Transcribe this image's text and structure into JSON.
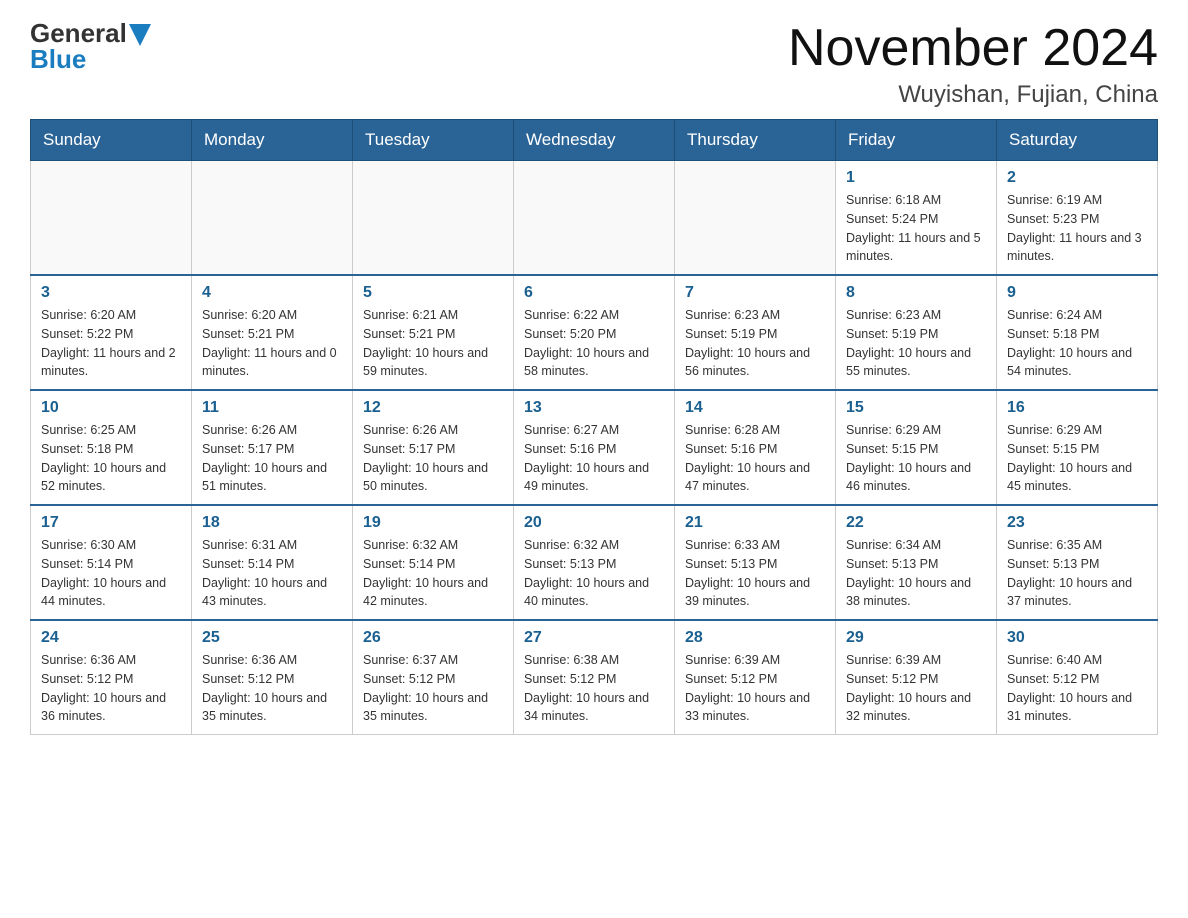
{
  "header": {
    "logo_general": "General",
    "logo_blue": "Blue",
    "title": "November 2024",
    "subtitle": "Wuyishan, Fujian, China"
  },
  "days_of_week": [
    "Sunday",
    "Monday",
    "Tuesday",
    "Wednesday",
    "Thursday",
    "Friday",
    "Saturday"
  ],
  "weeks": [
    [
      {
        "day": "",
        "info": ""
      },
      {
        "day": "",
        "info": ""
      },
      {
        "day": "",
        "info": ""
      },
      {
        "day": "",
        "info": ""
      },
      {
        "day": "",
        "info": ""
      },
      {
        "day": "1",
        "info": "Sunrise: 6:18 AM\nSunset: 5:24 PM\nDaylight: 11 hours and 5 minutes."
      },
      {
        "day": "2",
        "info": "Sunrise: 6:19 AM\nSunset: 5:23 PM\nDaylight: 11 hours and 3 minutes."
      }
    ],
    [
      {
        "day": "3",
        "info": "Sunrise: 6:20 AM\nSunset: 5:22 PM\nDaylight: 11 hours and 2 minutes."
      },
      {
        "day": "4",
        "info": "Sunrise: 6:20 AM\nSunset: 5:21 PM\nDaylight: 11 hours and 0 minutes."
      },
      {
        "day": "5",
        "info": "Sunrise: 6:21 AM\nSunset: 5:21 PM\nDaylight: 10 hours and 59 minutes."
      },
      {
        "day": "6",
        "info": "Sunrise: 6:22 AM\nSunset: 5:20 PM\nDaylight: 10 hours and 58 minutes."
      },
      {
        "day": "7",
        "info": "Sunrise: 6:23 AM\nSunset: 5:19 PM\nDaylight: 10 hours and 56 minutes."
      },
      {
        "day": "8",
        "info": "Sunrise: 6:23 AM\nSunset: 5:19 PM\nDaylight: 10 hours and 55 minutes."
      },
      {
        "day": "9",
        "info": "Sunrise: 6:24 AM\nSunset: 5:18 PM\nDaylight: 10 hours and 54 minutes."
      }
    ],
    [
      {
        "day": "10",
        "info": "Sunrise: 6:25 AM\nSunset: 5:18 PM\nDaylight: 10 hours and 52 minutes."
      },
      {
        "day": "11",
        "info": "Sunrise: 6:26 AM\nSunset: 5:17 PM\nDaylight: 10 hours and 51 minutes."
      },
      {
        "day": "12",
        "info": "Sunrise: 6:26 AM\nSunset: 5:17 PM\nDaylight: 10 hours and 50 minutes."
      },
      {
        "day": "13",
        "info": "Sunrise: 6:27 AM\nSunset: 5:16 PM\nDaylight: 10 hours and 49 minutes."
      },
      {
        "day": "14",
        "info": "Sunrise: 6:28 AM\nSunset: 5:16 PM\nDaylight: 10 hours and 47 minutes."
      },
      {
        "day": "15",
        "info": "Sunrise: 6:29 AM\nSunset: 5:15 PM\nDaylight: 10 hours and 46 minutes."
      },
      {
        "day": "16",
        "info": "Sunrise: 6:29 AM\nSunset: 5:15 PM\nDaylight: 10 hours and 45 minutes."
      }
    ],
    [
      {
        "day": "17",
        "info": "Sunrise: 6:30 AM\nSunset: 5:14 PM\nDaylight: 10 hours and 44 minutes."
      },
      {
        "day": "18",
        "info": "Sunrise: 6:31 AM\nSunset: 5:14 PM\nDaylight: 10 hours and 43 minutes."
      },
      {
        "day": "19",
        "info": "Sunrise: 6:32 AM\nSunset: 5:14 PM\nDaylight: 10 hours and 42 minutes."
      },
      {
        "day": "20",
        "info": "Sunrise: 6:32 AM\nSunset: 5:13 PM\nDaylight: 10 hours and 40 minutes."
      },
      {
        "day": "21",
        "info": "Sunrise: 6:33 AM\nSunset: 5:13 PM\nDaylight: 10 hours and 39 minutes."
      },
      {
        "day": "22",
        "info": "Sunrise: 6:34 AM\nSunset: 5:13 PM\nDaylight: 10 hours and 38 minutes."
      },
      {
        "day": "23",
        "info": "Sunrise: 6:35 AM\nSunset: 5:13 PM\nDaylight: 10 hours and 37 minutes."
      }
    ],
    [
      {
        "day": "24",
        "info": "Sunrise: 6:36 AM\nSunset: 5:12 PM\nDaylight: 10 hours and 36 minutes."
      },
      {
        "day": "25",
        "info": "Sunrise: 6:36 AM\nSunset: 5:12 PM\nDaylight: 10 hours and 35 minutes."
      },
      {
        "day": "26",
        "info": "Sunrise: 6:37 AM\nSunset: 5:12 PM\nDaylight: 10 hours and 35 minutes."
      },
      {
        "day": "27",
        "info": "Sunrise: 6:38 AM\nSunset: 5:12 PM\nDaylight: 10 hours and 34 minutes."
      },
      {
        "day": "28",
        "info": "Sunrise: 6:39 AM\nSunset: 5:12 PM\nDaylight: 10 hours and 33 minutes."
      },
      {
        "day": "29",
        "info": "Sunrise: 6:39 AM\nSunset: 5:12 PM\nDaylight: 10 hours and 32 minutes."
      },
      {
        "day": "30",
        "info": "Sunrise: 6:40 AM\nSunset: 5:12 PM\nDaylight: 10 hours and 31 minutes."
      }
    ]
  ]
}
